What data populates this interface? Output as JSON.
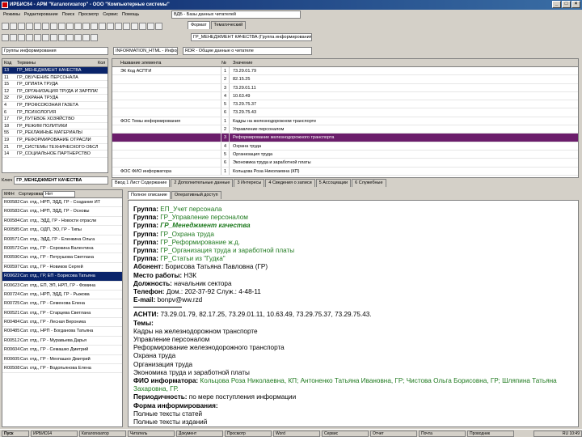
{
  "window": {
    "title": "ИРБИС64 - АРМ \"Каталогизатор\" - ООО \"Компьютерные системы\"",
    "minimize": "_",
    "maximize": "□",
    "close": "×"
  },
  "menu": [
    "Режимы",
    "Редактирование",
    "Поиск",
    "Просмотр",
    "Сервис",
    "Помощь"
  ],
  "db_label": "ВДБ - Базы данных читателей",
  "right_tabs": [
    "Формат",
    "Тематический"
  ],
  "right_field": "ГР_МЕНЕДЖМЕНТ КАЧЕСТВА (Группа информирования)",
  "left_combo": "Группы информирования",
  "mid_combo": "INFORMATION_HTML - Информ",
  "right_combo": "RDR - Общие данные о читателе",
  "dict": {
    "col_code": "Код",
    "col_term": "Термины",
    "col_count": "Кол",
    "rows": [
      {
        "code": "13",
        "term": "ГР_МЕНЕДЖМЕНТ КАЧЕСТВА",
        "count": "",
        "selected": true
      },
      {
        "code": "11",
        "term": "ГР_ОБУЧЕНИЕ ПЕРСОНАЛА",
        "count": ""
      },
      {
        "code": "15",
        "term": "ГР_ОПЛАТА ТРУДА",
        "count": ""
      },
      {
        "code": "12",
        "term": "ГР_ОРГАНИЗАЦИЯ ТРУДА И ЗАРПЛАТЫ",
        "count": ""
      },
      {
        "code": "32",
        "term": "ГР_ОХРАНА ТРУДА",
        "count": ""
      },
      {
        "code": "4",
        "term": "ГР_ПРОФСОЮЗНАЯ ГАЗЕТА",
        "count": ""
      },
      {
        "code": "6",
        "term": "ГР_ПСИХОЛОГИЯ",
        "count": ""
      },
      {
        "code": "17",
        "term": "ГР_ПУТЕВОЕ ХОЗЯЙСТВО",
        "count": ""
      },
      {
        "code": "18",
        "term": "ГР_РЕЖИМ ПОЛИТИКИ",
        "count": ""
      },
      {
        "code": "55",
        "term": "ГР_РЕКЛАМНЫЕ МАТЕРИАЛЫ",
        "count": ""
      },
      {
        "code": "19",
        "term": "ГР_РЕФОРМИРОВАНИЕ ОТРАСЛИ",
        "count": ""
      },
      {
        "code": "21",
        "term": "ГР_СИСТЕМЫ ТЕХНИЧЕСКОГО ОБСЛУЖИВАНИЯ",
        "count": ""
      },
      {
        "code": "14",
        "term": "ГР_СОЦИАЛЬНОЕ ПАРТНЕРСТВО",
        "count": ""
      }
    ],
    "key_label": "Ключ",
    "key_value": "ГР_МЕНЕДЖМЕНТ КАЧЕСТВА"
  },
  "fields": {
    "col_name": "Название элемента",
    "col_n": "№",
    "col_value": "Значение",
    "rows": [
      {
        "name": "ЭК Код АСПТИ",
        "n": "1",
        "value": "73.29.01.79"
      },
      {
        "name": "",
        "n": "2",
        "value": "82.15.25"
      },
      {
        "name": "",
        "n": "3",
        "value": "73.29.01.11"
      },
      {
        "name": "",
        "n": "4",
        "value": "10.63.49"
      },
      {
        "name": "",
        "n": "5",
        "value": "73.29.75.37"
      },
      {
        "name": "",
        "n": "6",
        "value": "73.29.75.43"
      },
      {
        "name": "ФОС Темы информирования",
        "n": "1",
        "value": "Кадры на железнодорожном транспорте"
      },
      {
        "name": "",
        "n": "2",
        "value": "Управление персоналом"
      },
      {
        "name": "",
        "n": "3",
        "value": "Реформирование железнодорожного транспорта",
        "selected": true
      },
      {
        "name": "",
        "n": "4",
        "value": "Охрана труда"
      },
      {
        "name": "",
        "n": "5",
        "value": "Организация труда"
      },
      {
        "name": "",
        "n": "6",
        "value": "Экономика труда и заработной платы"
      },
      {
        "name": "ФОС ФИО информатора",
        "n": "1",
        "value": "Кольцова Роза Николаевна (КП)"
      }
    ]
  },
  "bottom_tabs": [
    "Ввод 1 Лист Содержание",
    "2 Дополнительные данные",
    "3 Интересы",
    "4 Сведения о записи",
    "5 Ассоциации",
    "6 Служебные"
  ],
  "records": {
    "col_mfn": "МФН",
    "col_sort": "Сортировка",
    "sort_value": "Нет",
    "rows": [
      {
        "mfn": "R00582",
        "text": "Сат. отд., НРП, ЭДД, ГР - Создание ИТ"
      },
      {
        "mfn": "R00583",
        "text": "Сат. отд., НРП, ЭДД, ГР - Основы"
      },
      {
        "mfn": "R00584",
        "text": "Сат. отд., ЭДД, ГР - Новости отрасли"
      },
      {
        "mfn": "R00585",
        "text": "Сат. отд., ОДП, ЭО, ГР - Типы"
      },
      {
        "mfn": "R00571",
        "text": "Сат. отд., ЭДД, ГР - Еленкина Ольга"
      },
      {
        "mfn": "R00572",
        "text": "Сат. отд., ГР - Сорокина Валентина"
      },
      {
        "mfn": "R00590",
        "text": "Сат. отд., ГР - Петрушова Светлана"
      },
      {
        "mfn": "R00597",
        "text": "Сат. отд., ГР - Новиков Сергей"
      },
      {
        "mfn": "R00622",
        "text": "Сат. отд., ГР, ЕП - Борисова Татьяна",
        "selected": true
      },
      {
        "mfn": "R00623",
        "text": "Сат. отд., ЕП, ЭП, НРП, ГР - Фомина"
      },
      {
        "mfn": "R00724",
        "text": "Сат. отд., НРП, ЭДД, ГР - Рыжова"
      },
      {
        "mfn": "R00725",
        "text": "Сат. отд., ГР - Семенова Елена"
      },
      {
        "mfn": "R00521",
        "text": "Сат. отд., ГР - Старцева Светлана"
      },
      {
        "mfn": "R00484",
        "text": "Сат. отд., ГР - Лесная Вероника"
      },
      {
        "mfn": "R00485",
        "text": "Сат. отд., НРП - Богданова Татьяна"
      },
      {
        "mfn": "R00512",
        "text": "Сат. отд., ГР - Муравьева Дарья"
      },
      {
        "mfn": "R00604",
        "text": "Сат. отд., ГР - Семашко Дмитрий"
      },
      {
        "mfn": "R00605",
        "text": "Сат. отд., ГР - Мехпашко Дмитрий"
      },
      {
        "mfn": "R00508",
        "text": "Сат. отд., ГР - Водопьянова Елена"
      }
    ]
  },
  "view_tabs": [
    "Полное описание",
    "Оперативный доступ"
  ],
  "detail": {
    "groups": [
      {
        "label": "Группа:",
        "value": "ЕП_Учет персонала",
        "style": "green"
      },
      {
        "label": "Группа:",
        "value": "ГР_Управление персоналом",
        "style": "green"
      },
      {
        "label": "Группа:",
        "value": "ГР_Менеджмент качества",
        "style": "greenb"
      },
      {
        "label": "Группа:",
        "value": "ГР_Охрана труда",
        "style": "green"
      },
      {
        "label": "Группа:",
        "value": "ГР_Реформирование ж.д.",
        "style": "green"
      },
      {
        "label": "Группа:",
        "value": "ГР_Организация труда и заработной платы",
        "style": "green"
      },
      {
        "label": "Группа:",
        "value": "ГР_Статьи из \"Гудка\"",
        "style": "green"
      }
    ],
    "subscriber_label": "Абонент:",
    "subscriber": "Борисова Татьяна Павловна (ГР)",
    "work_label": "Место работы:",
    "work": "НЗК",
    "position_label": "Должность:",
    "position": "начальник сектора",
    "phone_label": "Телефон:",
    "phone": "Дом.: 202-37-92 Служ.: 4-48-11",
    "email_label": "E-mail:",
    "email": "bonpv@ww.rzd",
    "asnti_label": "АСНТИ:",
    "asnti": "73.29.01.79, 82.17.25, 73.29.01.11, 10.63.49, 73.29.75.37, 73.29.75.43.",
    "topics_label": "Темы:",
    "topics": [
      "Кадры на железнодорожном транспорте",
      "Управление персоналом",
      "Реформирование железнодорожного транспорта",
      "Охрана труда",
      "Организация труда",
      "Экономика труда и заработной платы"
    ],
    "informer_label": "ФИО информатора:",
    "informer": "Кольцова Роза Николаевна, КП; Антоненко Татьяна Ивановна, ГР; Чистова Ольга Борисовна, ГР; Шляпина Татьяна Захаровна, ГР.",
    "periodicity_label": "Периодичность:",
    "periodicity": "по мере поступления информации",
    "form_label": "Форма информирования:",
    "forms": [
      "Полные тексты статей",
      "Полные тексты изданий"
    ]
  },
  "taskbar": {
    "start": "Пуск",
    "tasks": [
      "ИРБИС64",
      "Каталогизатор",
      "Читатель",
      "Документ",
      "Просмотр",
      "Word",
      "Сервис",
      "Отчет",
      "Почта",
      "Проводник"
    ],
    "clock": "RU 10:49"
  }
}
